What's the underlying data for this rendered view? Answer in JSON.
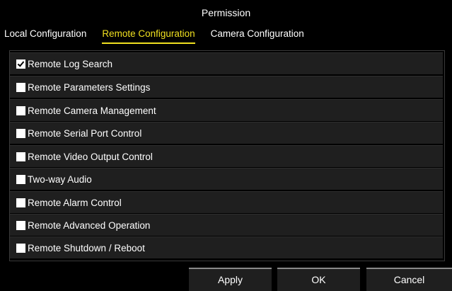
{
  "dialog": {
    "title": "Permission"
  },
  "tabs": [
    {
      "label": "Local Configuration",
      "active": false
    },
    {
      "label": "Remote Configuration",
      "active": true
    },
    {
      "label": "Camera Configuration",
      "active": false
    }
  ],
  "permissions": [
    {
      "label": "Remote Log Search",
      "checked": true
    },
    {
      "label": "Remote Parameters Settings",
      "checked": false
    },
    {
      "label": "Remote Camera Management",
      "checked": false
    },
    {
      "label": "Remote Serial Port Control",
      "checked": false
    },
    {
      "label": "Remote Video Output Control",
      "checked": false
    },
    {
      "label": "Two-way Audio",
      "checked": false
    },
    {
      "label": "Remote Alarm Control",
      "checked": false
    },
    {
      "label": "Remote Advanced Operation",
      "checked": false
    },
    {
      "label": "Remote Shutdown / Reboot",
      "checked": false
    }
  ],
  "buttons": {
    "apply": "Apply",
    "ok": "OK",
    "cancel": "Cancel"
  },
  "colors": {
    "active_tab": "#f0e020",
    "row_background": "#1f1f1f"
  }
}
